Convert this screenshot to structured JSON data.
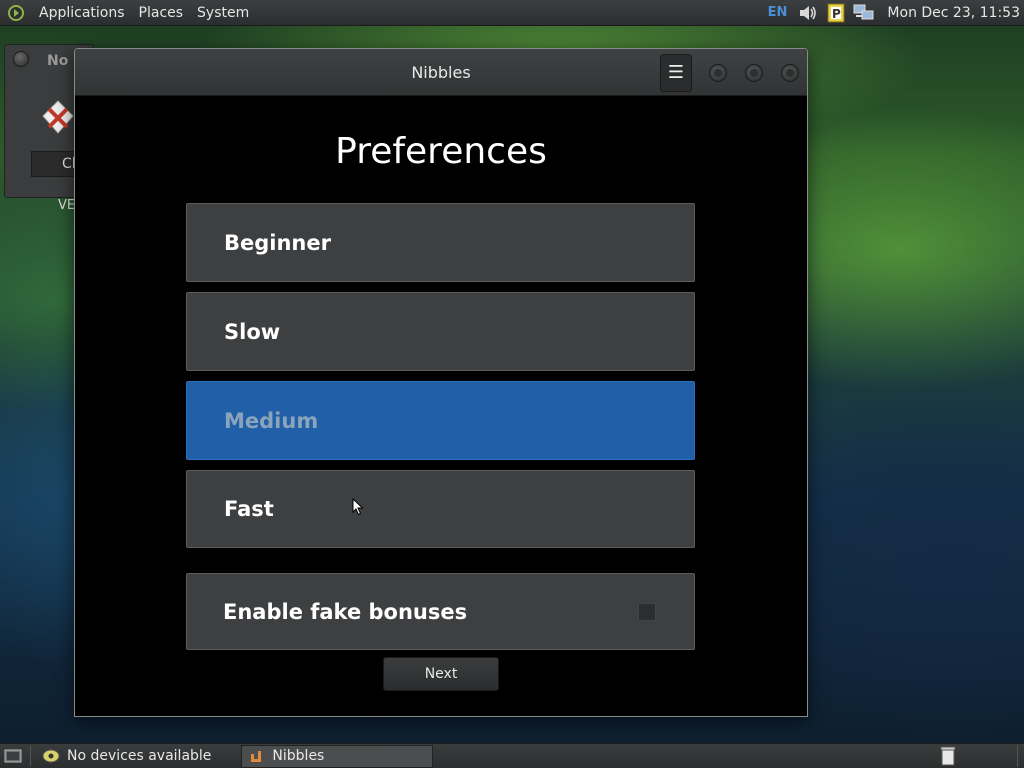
{
  "top_panel": {
    "menus": [
      "Applications",
      "Places",
      "System"
    ],
    "keyboard_layout": "EN",
    "clock": "Mon Dec 23, 11:53"
  },
  "background_dialog": {
    "title_fragment": "No d",
    "button_fragment": "Clo",
    "caption_fragment": "VE"
  },
  "window": {
    "title": "Nibbles",
    "menu_icon": "☰",
    "heading": "Preferences",
    "speed_options": [
      {
        "label": "Beginner",
        "selected": false
      },
      {
        "label": "Slow",
        "selected": false
      },
      {
        "label": "Medium",
        "selected": true
      },
      {
        "label": "Fast",
        "selected": false
      }
    ],
    "fake_bonuses": {
      "label": "Enable fake bonuses",
      "checked": false
    },
    "next_label": "Next"
  },
  "bottom_panel": {
    "devices_text": "No devices available",
    "task_label": "Nibbles"
  },
  "colors": {
    "selected": "#2160a8",
    "option_bg": "#3d3f40",
    "accent_en": "#4a90d9"
  }
}
